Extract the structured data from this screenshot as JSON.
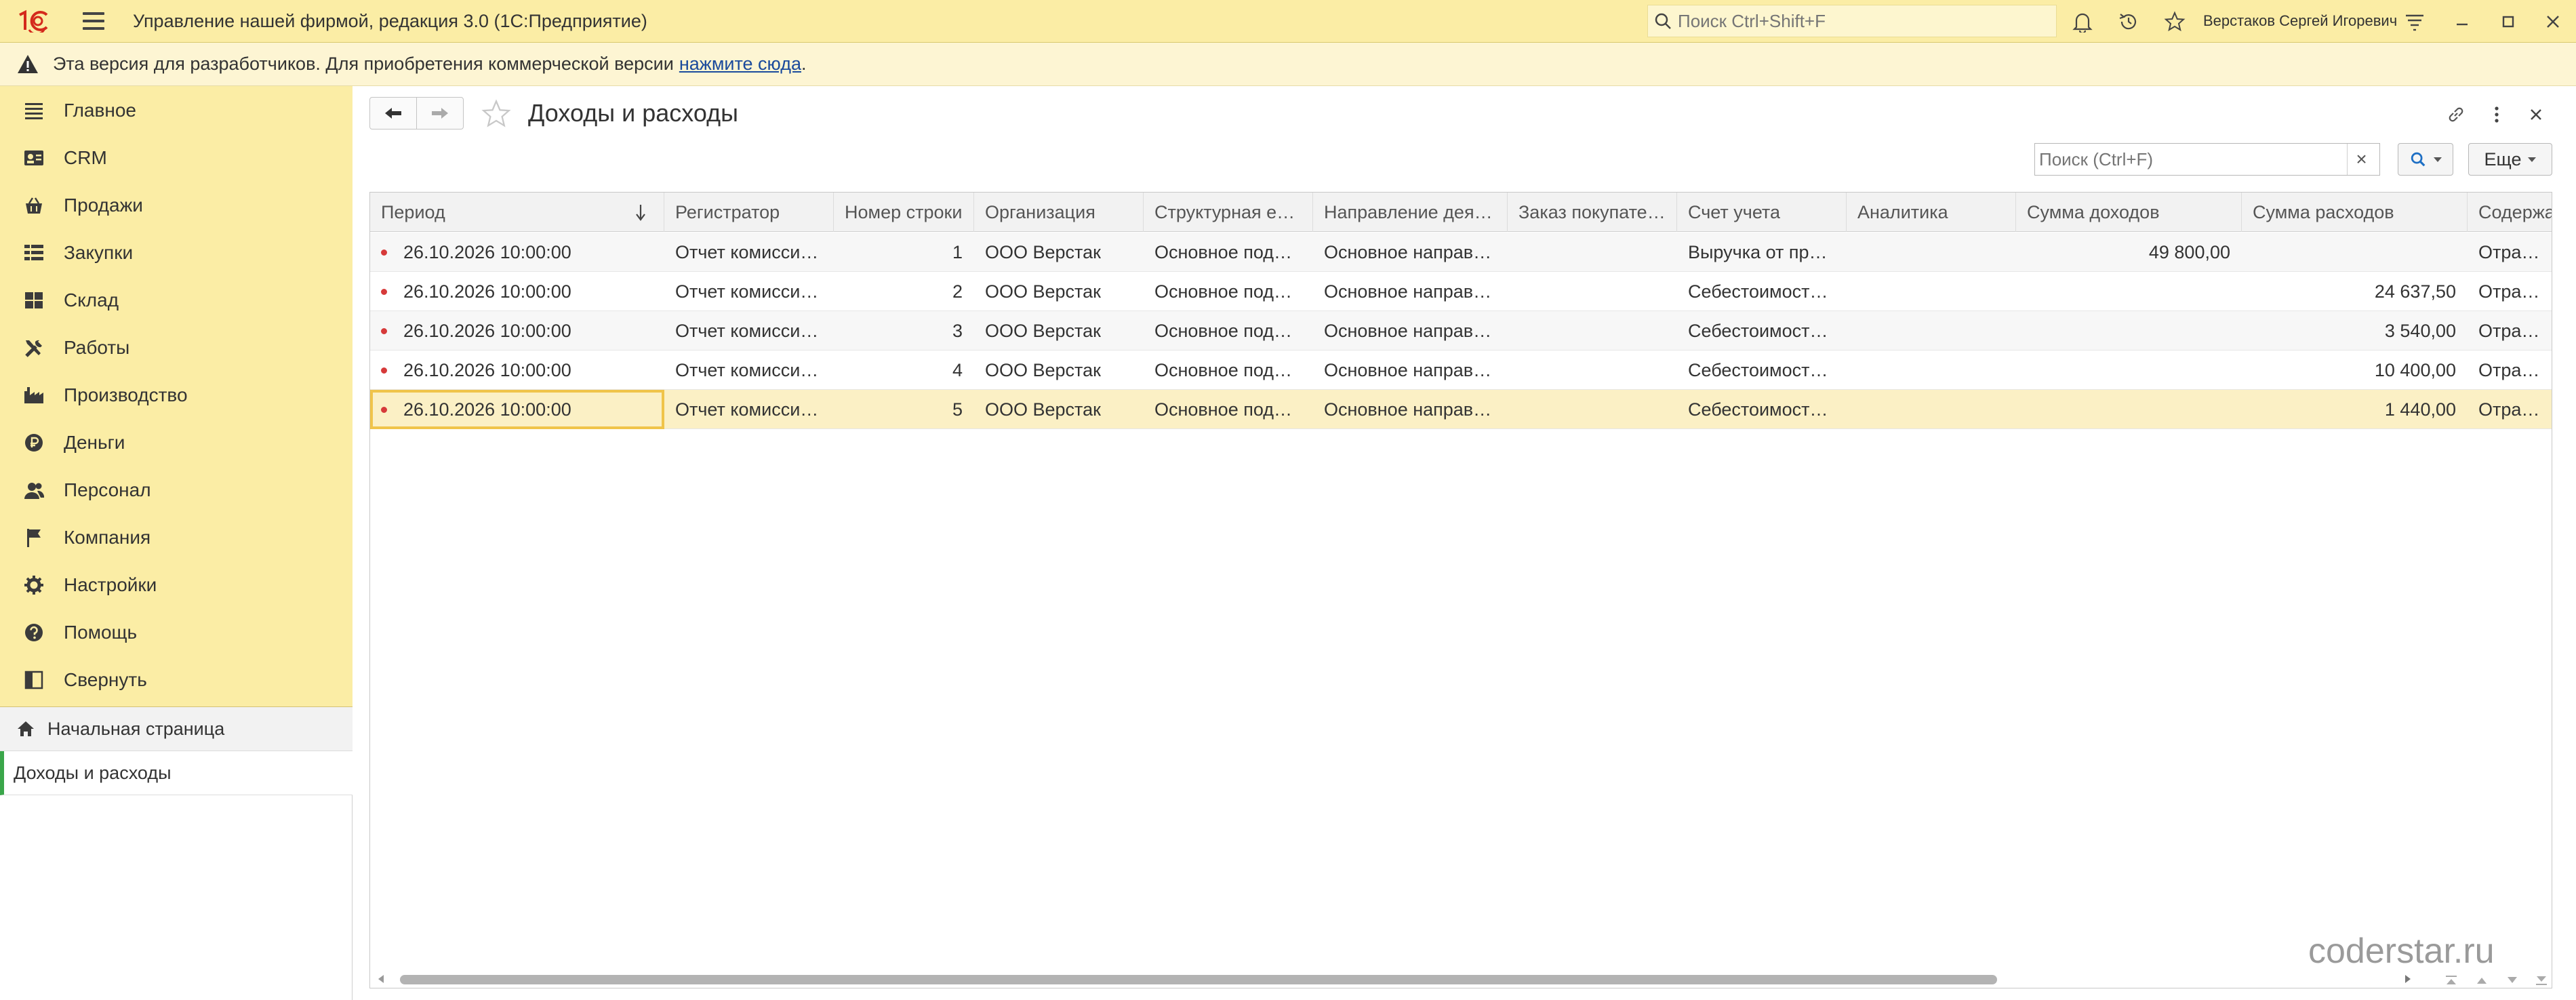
{
  "titlebar": {
    "app_title": "Управление нашей фирмой, редакция 3.0  (1С:Предприятие)",
    "search_placeholder": "Поиск Ctrl+Shift+F",
    "user_name": "Верстаков Сергей Игоревич"
  },
  "banner": {
    "text": "Эта версия для разработчиков. Для приобретения коммерческой версии",
    "link": "нажмите сюда",
    "suffix": "."
  },
  "sidebar": {
    "sections": [
      {
        "label": "Главное",
        "icon": "list-icon"
      },
      {
        "label": "CRM",
        "icon": "contacts-icon"
      },
      {
        "label": "Продажи",
        "icon": "basket-icon"
      },
      {
        "label": "Закупки",
        "icon": "purchases-icon"
      },
      {
        "label": "Склад",
        "icon": "warehouse-icon"
      },
      {
        "label": "Работы",
        "icon": "tools-icon"
      },
      {
        "label": "Производство",
        "icon": "factory-icon"
      },
      {
        "label": "Деньги",
        "icon": "money-icon"
      },
      {
        "label": "Персонал",
        "icon": "people-icon"
      },
      {
        "label": "Компания",
        "icon": "flag-icon"
      },
      {
        "label": "Настройки",
        "icon": "gear-icon"
      },
      {
        "label": "Помощь",
        "icon": "help-icon"
      },
      {
        "label": "Свернуть",
        "icon": "collapse-icon"
      }
    ],
    "open_windows": [
      {
        "label": "Начальная страница",
        "icon": "home-icon"
      },
      {
        "label": "Доходы и расходы"
      }
    ]
  },
  "form": {
    "title": "Доходы и расходы",
    "search_placeholder": "Поиск (Ctrl+F)",
    "search_clear": "×",
    "more_label": "Еще"
  },
  "table": {
    "columns": [
      "Период",
      "Регистратор",
      "Номер строки",
      "Организация",
      "Структурная е…",
      "Направление дея…",
      "Заказ покупате…",
      "Счет учета",
      "Аналитика",
      "Сумма доходов",
      "Сумма расходов",
      "Содержа"
    ],
    "rows": [
      {
        "period": "26.10.2026 10:00:00",
        "registrar": "Отчет комисси…",
        "line": "1",
        "org": "ООО Верстак",
        "unit": "Основное под…",
        "direction": "Основное направ…",
        "order": "",
        "account": "Выручка от пр…",
        "analytics": "",
        "income": "49 800,00",
        "expense": "",
        "content": "Отражен"
      },
      {
        "period": "26.10.2026 10:00:00",
        "registrar": "Отчет комисси…",
        "line": "2",
        "org": "ООО Верстак",
        "unit": "Основное под…",
        "direction": "Основное направ…",
        "order": "",
        "account": "Себестоимост…",
        "analytics": "",
        "income": "",
        "expense": "24 637,50",
        "content": "Отражен"
      },
      {
        "period": "26.10.2026 10:00:00",
        "registrar": "Отчет комисси…",
        "line": "3",
        "org": "ООО Верстак",
        "unit": "Основное под…",
        "direction": "Основное направ…",
        "order": "",
        "account": "Себестоимост…",
        "analytics": "",
        "income": "",
        "expense": "3 540,00",
        "content": "Отражен"
      },
      {
        "period": "26.10.2026 10:00:00",
        "registrar": "Отчет комисси…",
        "line": "4",
        "org": "ООО Верстак",
        "unit": "Основное под…",
        "direction": "Основное направ…",
        "order": "",
        "account": "Себестоимост…",
        "analytics": "",
        "income": "",
        "expense": "10 400,00",
        "content": "Отражен"
      },
      {
        "period": "26.10.2026 10:00:00",
        "registrar": "Отчет комисси…",
        "line": "5",
        "org": "ООО Верстак",
        "unit": "Основное под…",
        "direction": "Основное направ…",
        "order": "",
        "account": "Себестоимост…",
        "analytics": "",
        "income": "",
        "expense": "1 440,00",
        "content": "Отражен"
      }
    ],
    "selected_row": 4
  },
  "watermark": "coderstar.ru"
}
